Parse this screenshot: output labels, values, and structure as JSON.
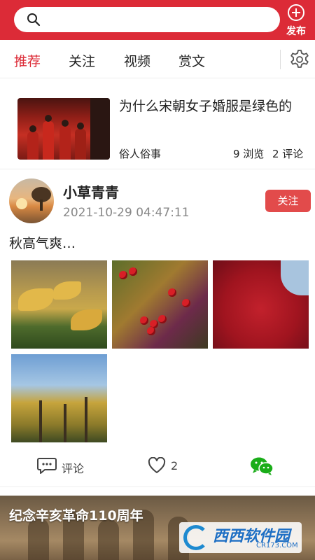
{
  "header": {
    "search_placeholder": "",
    "publish_label": "发布"
  },
  "tabs": [
    {
      "label": "推荐",
      "active": true
    },
    {
      "label": "关注",
      "active": false
    },
    {
      "label": "视频",
      "active": false
    },
    {
      "label": "赏文",
      "active": false
    }
  ],
  "article": {
    "title": "为什么宋朝女子婚服是绿色的",
    "source": "俗人俗事",
    "views": "9 浏览",
    "comments": "2 评论"
  },
  "post": {
    "username": "小草青青",
    "timestamp": "2021-10-29 04:47:11",
    "follow_label": "关注",
    "text": "秋高气爽…",
    "comment_label": "评论",
    "like_count": "2"
  },
  "banner": {
    "title": "纪念辛亥革命110周年",
    "watermark_text": "西西软件园",
    "watermark_url": "CR173.COM"
  },
  "colors": {
    "brand_red": "#dc2b37",
    "follow_red": "#e24b4b",
    "wechat_green": "#1aad19"
  },
  "icons": [
    "search-icon",
    "add-circle-icon",
    "settings-gear-icon",
    "comment-icon",
    "heart-icon",
    "wechat-icon"
  ]
}
